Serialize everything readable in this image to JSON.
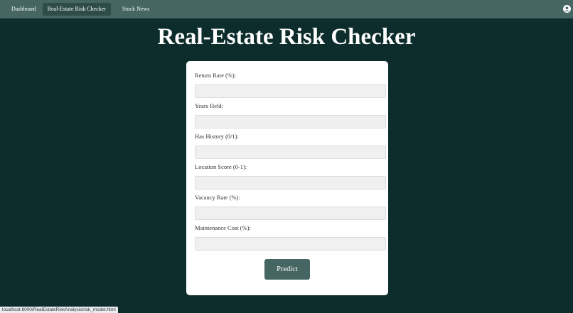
{
  "nav": {
    "items": [
      {
        "label": "Dashboard"
      },
      {
        "label": "Real-Estate Risk Checker",
        "active": true
      },
      {
        "label": "Stock News"
      }
    ],
    "user_icon": "user-circle-icon"
  },
  "page": {
    "title": "Real-Estate Risk Checker"
  },
  "form": {
    "fields": [
      {
        "label": "Return Rate (%):",
        "value": ""
      },
      {
        "label": "Years Held:",
        "value": ""
      },
      {
        "label": "Has History (0/1):",
        "value": ""
      },
      {
        "label": "Location Score (0-1):",
        "value": ""
      },
      {
        "label": "Vacancy Rate (%):",
        "value": ""
      },
      {
        "label": "Maintenance Cost (%):",
        "value": ""
      }
    ],
    "submit_label": "Predict"
  },
  "status_bar": {
    "url": "localhost:8000/RealEstateRiskAnalysis/risk_model.html"
  },
  "colors": {
    "background": "#0d2c2c",
    "navbar": "#456663",
    "nav_active": "#2e4d4a",
    "button": "#456663",
    "card": "#ffffff"
  }
}
